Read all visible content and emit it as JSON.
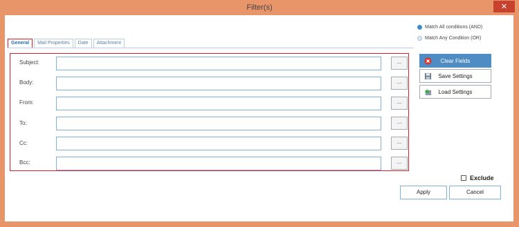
{
  "window": {
    "title": "Filter(s)",
    "close_glyph": "✕"
  },
  "match": {
    "all_label": "Match All conditions (AND)",
    "any_label": "Match Any Condition (OR)",
    "selected": "all"
  },
  "tabs": [
    {
      "label": "General",
      "selected": true
    },
    {
      "label": "Mail Properties"
    },
    {
      "label": "Date"
    },
    {
      "label": "Attachment"
    }
  ],
  "fields": [
    {
      "label": "Subject:",
      "value": "",
      "button": "..."
    },
    {
      "label": "Body:",
      "value": "",
      "button": "..."
    },
    {
      "label": "From:",
      "value": "",
      "button": "..."
    },
    {
      "label": "To:",
      "value": "",
      "button": "..."
    },
    {
      "label": "Cc:",
      "value": "",
      "button": "..."
    },
    {
      "label": "Bcc:",
      "value": "",
      "button": "..."
    }
  ],
  "actions": {
    "clear": {
      "label": "Clear Fields",
      "icon": "clear-icon"
    },
    "save": {
      "label": "Save Settings",
      "icon": "save-icon"
    },
    "load": {
      "label": "Load Settings",
      "icon": "load-icon"
    }
  },
  "exclude": {
    "label": "Exclude",
    "checked": false
  },
  "footer": {
    "apply": "Apply",
    "cancel": "Cancel"
  },
  "colors": {
    "accent": "#4f8cc4",
    "highlight": "#d61f26",
    "frame": "#e8956a"
  }
}
